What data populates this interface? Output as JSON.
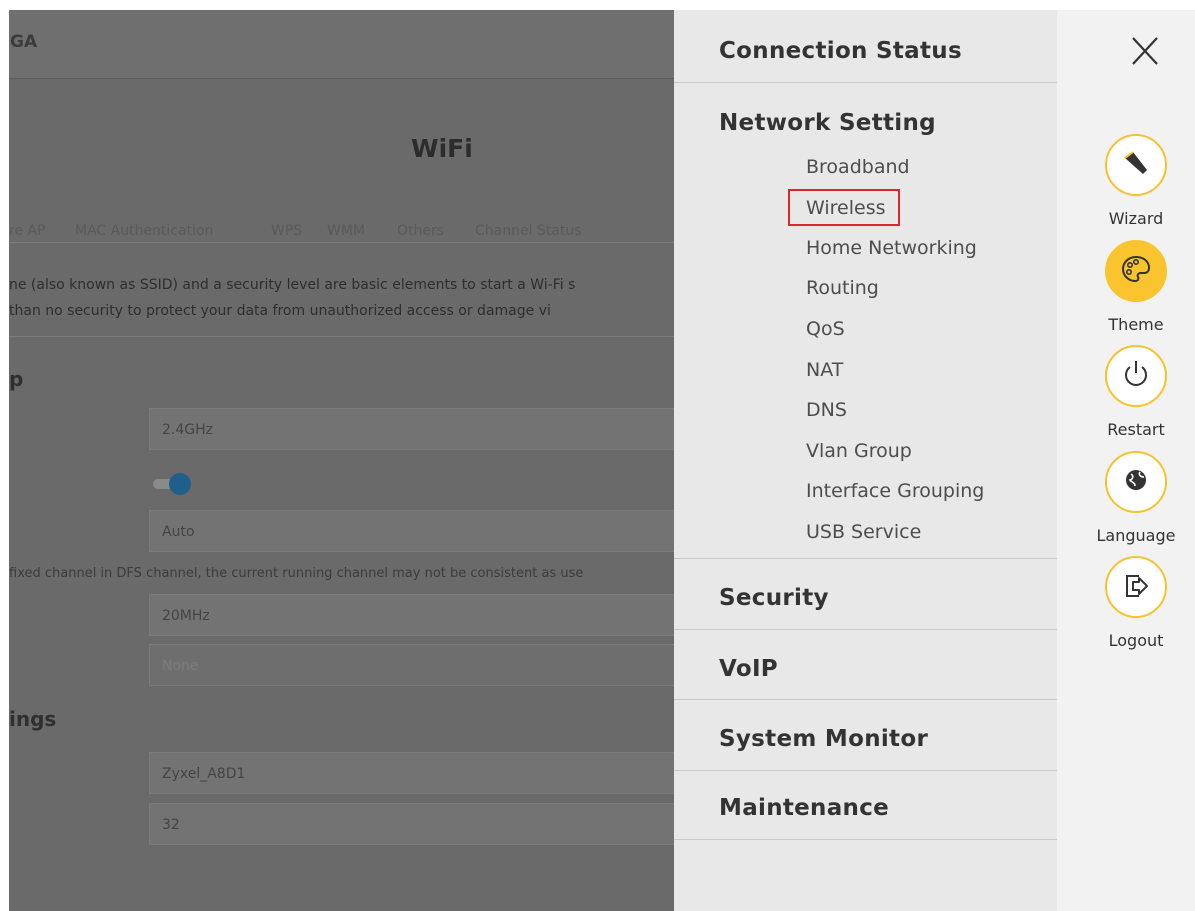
{
  "background_page": {
    "brand": "GA",
    "title": "WiFi",
    "tabs": [
      "re AP",
      "MAC Authentication",
      "WPS",
      "WMM",
      "Others",
      "Channel Status"
    ],
    "description_line1": "ne (also known as SSID) and a security level are basic elements to start a Wi-Fi s",
    "description_line2": "than no security to protect your data from unauthorized access or damage vi",
    "section_setup": "p",
    "band": "2.4GHz",
    "channel": "Auto",
    "channel_hint": "fixed channel in DFS channel, the current running channel may not be consistent as use",
    "bandwidth": "20MHz",
    "disabled_field": "None",
    "section_settings": "ings",
    "ssid": "Zyxel_A8D1",
    "max_clients": "32"
  },
  "menu": {
    "connection_status": "Connection Status",
    "network_setting": "Network Setting",
    "network_items": [
      "Broadband",
      "Wireless",
      "Home Networking",
      "Routing",
      "QoS",
      "NAT",
      "DNS",
      "Vlan Group",
      "Interface Grouping",
      "USB Service"
    ],
    "security": "Security",
    "voip": "VoIP",
    "system_monitor": "System Monitor",
    "maintenance": "Maintenance",
    "highlight_color": "#d8272d"
  },
  "sidebar": {
    "wizard": "Wizard",
    "theme": "Theme",
    "restart": "Restart",
    "language": "Language",
    "logout": "Logout",
    "accent": "#f9c42d"
  }
}
